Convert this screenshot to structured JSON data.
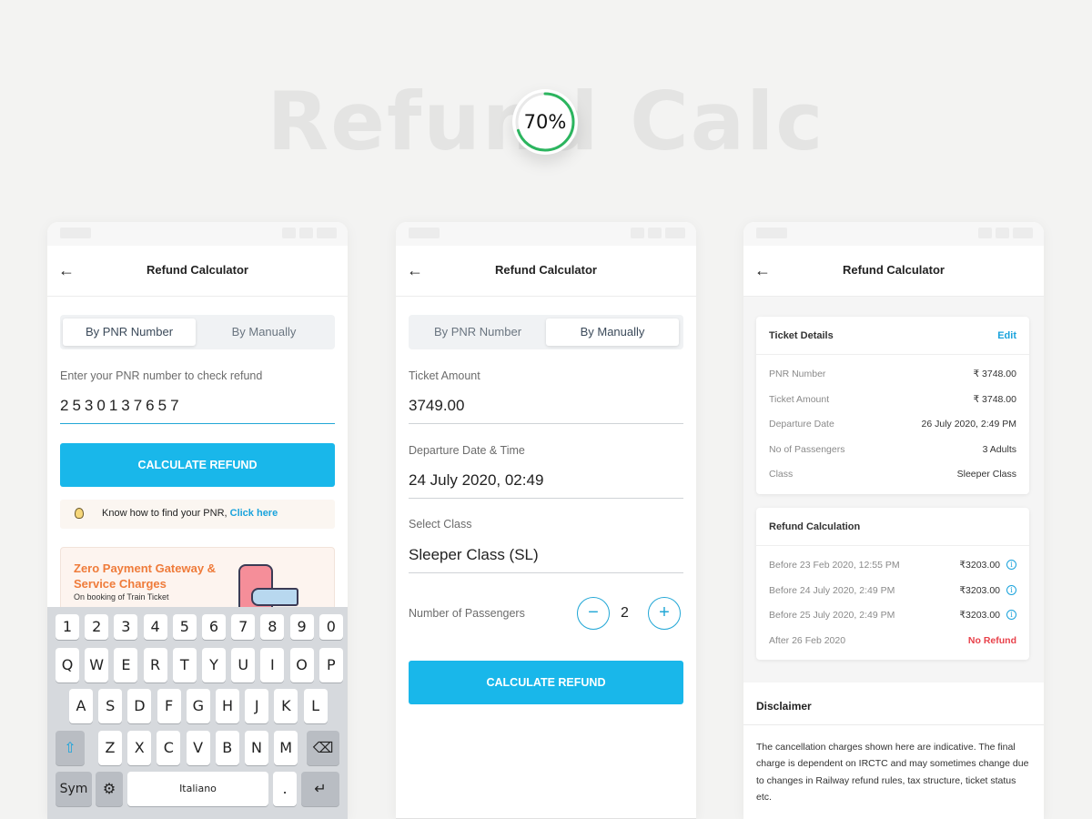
{
  "hero": {
    "title": "Refund Calc",
    "progress_text": "70%",
    "progress_value": 0.7,
    "progress_color": "#2cb55f"
  },
  "accent": "#19b7ea",
  "app": {
    "title": "Refund Calculator"
  },
  "tabs": {
    "pnr": "By PNR Number",
    "manual": "By Manually"
  },
  "screen1": {
    "hint": "Enter your PNR number to check refund",
    "pnr_value": "2530137657",
    "cta": "CALCULATE REFUND",
    "tip_text": "Know how to find your PNR, ",
    "tip_link": "Click here",
    "promo_title": "Zero Payment Gateway & Service Charges",
    "promo_sub": "On booking of Train Ticket"
  },
  "keyboard": {
    "numbers": [
      "1",
      "2",
      "3",
      "4",
      "5",
      "6",
      "7",
      "8",
      "9",
      "0"
    ],
    "row1": [
      "Q",
      "W",
      "E",
      "R",
      "T",
      "Y",
      "U",
      "I",
      "O",
      "P"
    ],
    "row2": [
      "A",
      "S",
      "D",
      "F",
      "G",
      "H",
      "J",
      "K",
      "L"
    ],
    "row3": [
      "Z",
      "X",
      "C",
      "V",
      "B",
      "N",
      "M"
    ],
    "sym": "Sym",
    "space": "Italiano",
    "period": "."
  },
  "screen2": {
    "ticket_amount_label": "Ticket Amount",
    "ticket_amount": "3749.00",
    "departure_label": "Departure Date & Time",
    "departure": "24 July 2020, 02:49",
    "class_label": "Select Class",
    "class_value": "Sleeper Class (SL)",
    "passengers_label": "Number of Passengers",
    "passengers": "2",
    "minus": "−",
    "plus": "+",
    "cta": "CALCULATE REFUND"
  },
  "screen3": {
    "ticket_details_title": "Ticket Details",
    "edit": "Edit",
    "details": [
      {
        "k": "PNR Number",
        "v": "₹ 3748.00"
      },
      {
        "k": "Ticket Amount",
        "v": "₹ 3748.00"
      },
      {
        "k": "Departure Date",
        "v": "26 July 2020, 2:49 PM"
      },
      {
        "k": "No of Passengers",
        "v": "3 Adults"
      },
      {
        "k": "Class",
        "v": "Sleeper Class"
      }
    ],
    "refund_title": "Refund Calculation",
    "refunds": [
      {
        "k": "Before 23 Feb 2020, 12:55 PM",
        "v": "₹3203.00"
      },
      {
        "k": "Before 24 July 2020, 2:49 PM",
        "v": "₹3203.00"
      },
      {
        "k": "Before 25 July 2020, 2:49 PM",
        "v": "₹3203.00"
      },
      {
        "k": "After 26 Feb 2020",
        "v": "No Refund"
      }
    ],
    "disclaimer_title": "Disclaimer",
    "disclaimer_text": "The cancellation charges shown here are indicative. The final charge is dependent on IRCTC and may sometimes change due to changes in Railway refund rules, tax structure, ticket status etc."
  }
}
